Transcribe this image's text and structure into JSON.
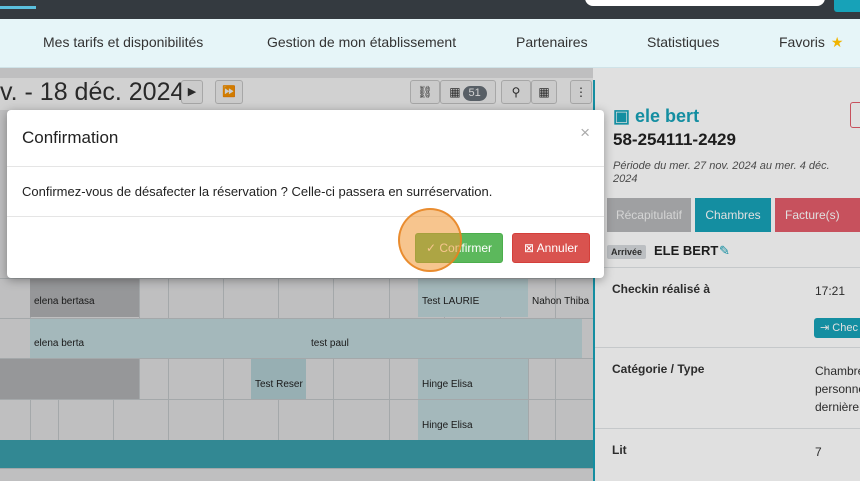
{
  "menu": {
    "items": [
      {
        "label": "Mes tarifs et disponibilités"
      },
      {
        "label": "Gestion de mon établissement"
      },
      {
        "label": "Partenaires"
      },
      {
        "label": "Statistiques"
      },
      {
        "label": "Favoris"
      }
    ]
  },
  "planning": {
    "date_range": "v. - 18 déc. 2024",
    "badge_count": "51",
    "bookings": {
      "b1": "elena bertasa",
      "b2": "Test LAURIE",
      "b3": "Nahon Thiba",
      "b4": "elena berta",
      "b5": "test paul",
      "b6": "Test Reser",
      "b7": "Hinge Elisa",
      "b8": "Hinge Elisa"
    }
  },
  "panel": {
    "guest_name": "ele bert",
    "phone": "58-254111-2429",
    "period": "Période du mer. 27 nov. 2024 au mer. 4 déc. 2024",
    "tabs": {
      "recap": "Récapitulatif",
      "chambres": "Chambres",
      "factures": "Facture(s)"
    },
    "arrivee_badge": "Arrivée",
    "arrivee_name": "ELE BERT",
    "rows": {
      "checkin_label": "Checkin réalisé à",
      "checkin_value": "17:21",
      "checkout_button": "Chec",
      "category_label": "Catégorie / Type",
      "category_value_1": "Chambre",
      "category_value_2": "personne",
      "category_value_3": "dernière",
      "lit_label": "Lit",
      "lit_value": "7"
    }
  },
  "modal": {
    "title": "Confirmation",
    "close": "×",
    "body": "Confirmez-vous de désafecter la réservation ? Celle-ci passera en surréservation.",
    "confirm_label": "Confirmer",
    "cancel_label": "Annuler"
  }
}
